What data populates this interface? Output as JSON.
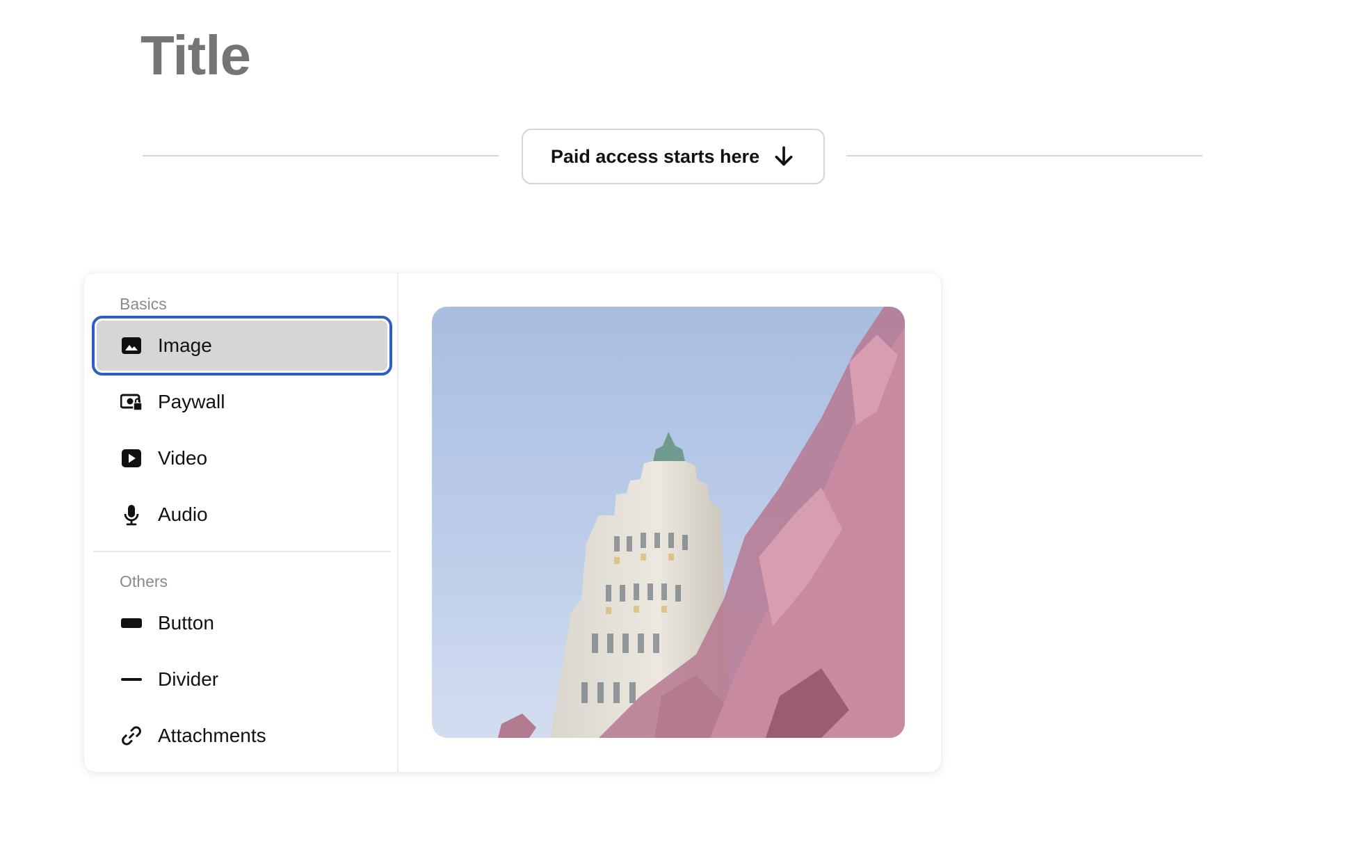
{
  "page": {
    "title": "Title"
  },
  "paywall": {
    "label": "Paid access starts here"
  },
  "insert_menu": {
    "sections": [
      {
        "label": "Basics",
        "items": [
          {
            "label": "Image",
            "icon": "image-icon",
            "selected": true
          },
          {
            "label": "Paywall",
            "icon": "paywall-icon"
          },
          {
            "label": "Video",
            "icon": "video-icon"
          },
          {
            "label": "Audio",
            "icon": "microphone-icon"
          }
        ]
      },
      {
        "label": "Others",
        "items": [
          {
            "label": "Button",
            "icon": "button-icon"
          },
          {
            "label": "Divider",
            "icon": "divider-icon"
          },
          {
            "label": "Attachments",
            "icon": "paperclip-icon"
          }
        ]
      }
    ]
  },
  "colors": {
    "selection_outline": "#2d5fc2",
    "selected_background": "#d6d6d6",
    "title": "#757575",
    "section_label": "#8a8a8a"
  }
}
